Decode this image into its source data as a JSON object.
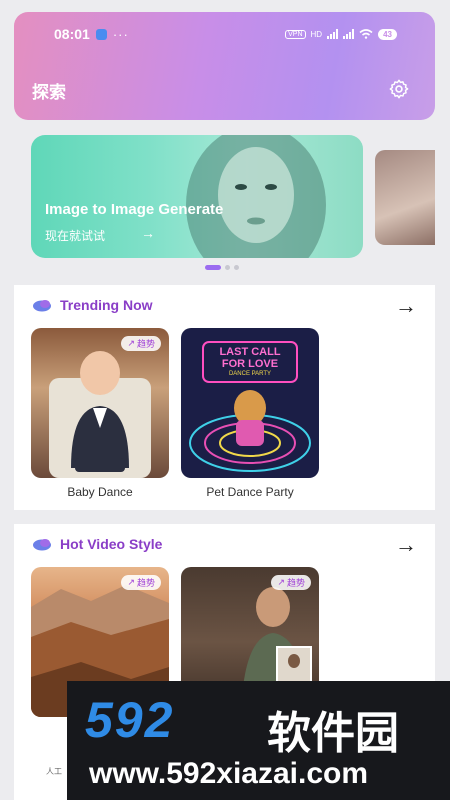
{
  "status_bar": {
    "time": "08:01",
    "dots": "···",
    "vpn": "VPN",
    "hd": "HD",
    "battery": "43"
  },
  "header": {
    "title": "探索",
    "settings_icon": "gear-icon"
  },
  "banner": {
    "title": "Image to Image Generate",
    "subtitle": "现在就试试",
    "arrow": "→"
  },
  "carousel": {
    "count": 3,
    "active": 0
  },
  "sections": [
    {
      "title": "Trending Now",
      "arrow": "→",
      "cards": [
        {
          "label": "Baby Dance",
          "badge": "趋势"
        },
        {
          "label": "Pet Dance Party",
          "badge": "",
          "poster_line1": "LAST CALL",
          "poster_line2": "FOR LOVE",
          "poster_line3": "DANCE PARTY"
        }
      ]
    },
    {
      "title": "Hot Video Style",
      "arrow": "→",
      "cards": [
        {
          "badge": "趋势"
        },
        {
          "badge": "趋势"
        }
      ]
    }
  ],
  "watermark": {
    "number": "592",
    "brand": "软件园",
    "url": "www.592xiazai.com"
  },
  "bottom": {
    "partial_text": "人工"
  },
  "colors": {
    "accent": "#8a3ec7",
    "header_start": "#e48fc0",
    "header_end": "#b391f0",
    "banner": "#7fe0c8"
  }
}
